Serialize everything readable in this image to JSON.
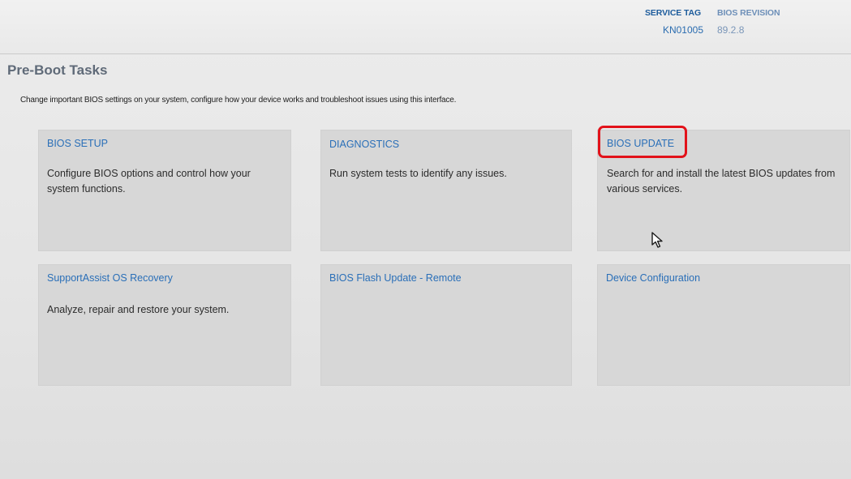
{
  "header": {
    "service_tag_label": "SERVICE TAG",
    "service_tag_value": "KN01005",
    "bios_revision_label": "BIOS REVISION",
    "bios_revision_value": "89.2.8"
  },
  "page": {
    "title": "Pre-Boot Tasks",
    "subtitle": "Change important BIOS settings on your system, configure how your device works and troubleshoot issues using this interface."
  },
  "tiles": [
    {
      "title": "BIOS SETUP",
      "description": "Configure BIOS options and control how your system functions."
    },
    {
      "title": "DIAGNOSTICS",
      "description": "Run system tests to identify any issues."
    },
    {
      "title": "BIOS UPDATE",
      "description": "Search for and install the latest BIOS updates from various services."
    },
    {
      "title": "SupportAssist OS Recovery",
      "description": "Analyze, repair and restore your system."
    },
    {
      "title": "BIOS Flash Update - Remote",
      "description": ""
    },
    {
      "title": "Device Configuration",
      "description": ""
    }
  ],
  "colors": {
    "tile_title": "#2a6fb8",
    "highlight": "#e2121a",
    "tile_background": "#d7d7d7"
  },
  "icons": {
    "cursor": "mouse-pointer-icon"
  }
}
